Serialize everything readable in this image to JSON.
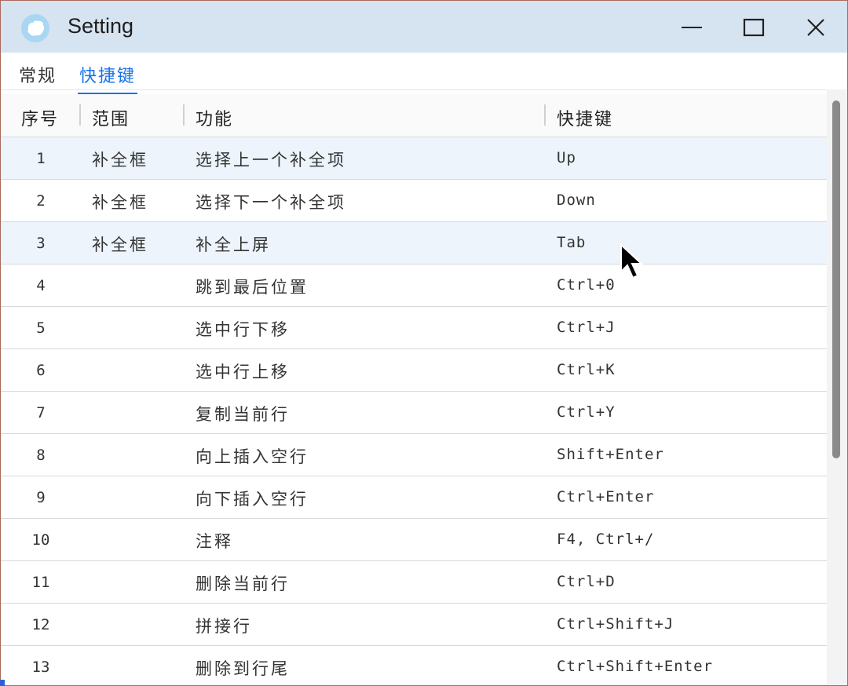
{
  "window": {
    "title": "Setting"
  },
  "tabs": [
    {
      "label": "常规",
      "active": false
    },
    {
      "label": "快捷键",
      "active": true
    }
  ],
  "table": {
    "headers": {
      "index": "序号",
      "scope": "范围",
      "function": "功能",
      "shortcut": "快捷键"
    },
    "rows": [
      {
        "index": "1",
        "scope": "补全框",
        "function": "选择上一个补全项",
        "shortcut": "Up"
      },
      {
        "index": "2",
        "scope": "补全框",
        "function": "选择下一个补全项",
        "shortcut": "Down"
      },
      {
        "index": "3",
        "scope": "补全框",
        "function": "补全上屏",
        "shortcut": "Tab"
      },
      {
        "index": "4",
        "scope": "",
        "function": "跳到最后位置",
        "shortcut": "Ctrl+0"
      },
      {
        "index": "5",
        "scope": "",
        "function": "选中行下移",
        "shortcut": "Ctrl+J"
      },
      {
        "index": "6",
        "scope": "",
        "function": "选中行上移",
        "shortcut": "Ctrl+K"
      },
      {
        "index": "7",
        "scope": "",
        "function": "复制当前行",
        "shortcut": "Ctrl+Y"
      },
      {
        "index": "8",
        "scope": "",
        "function": "向上插入空行",
        "shortcut": "Shift+Enter"
      },
      {
        "index": "9",
        "scope": "",
        "function": "向下插入空行",
        "shortcut": "Ctrl+Enter"
      },
      {
        "index": "10",
        "scope": "",
        "function": "注释",
        "shortcut": "F4, Ctrl+/"
      },
      {
        "index": "11",
        "scope": "",
        "function": "删除当前行",
        "shortcut": "Ctrl+D"
      },
      {
        "index": "12",
        "scope": "",
        "function": "拼接行",
        "shortcut": "Ctrl+Shift+J"
      },
      {
        "index": "13",
        "scope": "",
        "function": "删除到行尾",
        "shortcut": "Ctrl+Shift+Enter"
      }
    ]
  },
  "colors": {
    "titlebar": "#d6e3f0",
    "accent": "#1a73e8",
    "row_highlight": "#edf4fc"
  },
  "icons": {
    "app": "app-logo-icon",
    "minimize": "minimize-icon",
    "maximize": "maximize-icon",
    "close": "close-icon",
    "pointer": "mouse-pointer-icon"
  }
}
